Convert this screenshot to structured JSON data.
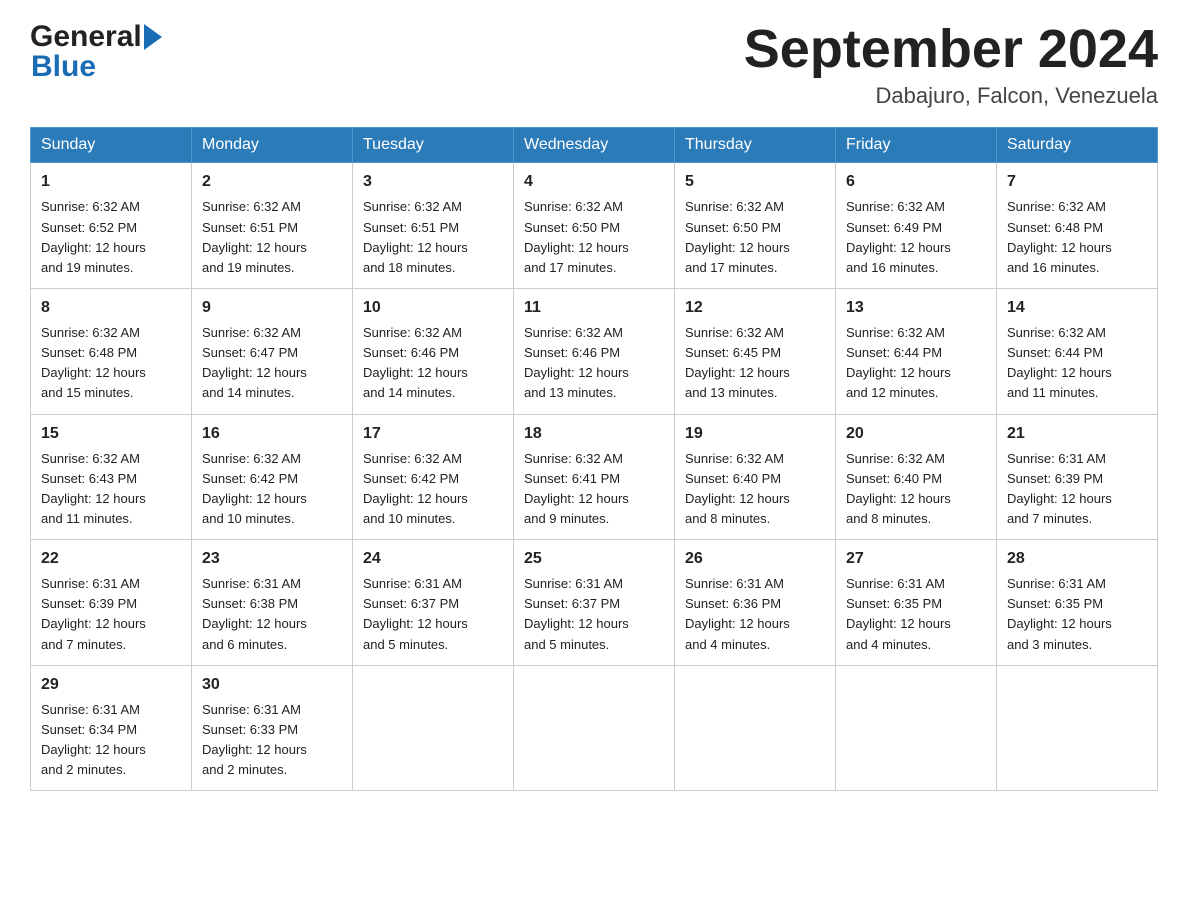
{
  "header": {
    "logo_general": "General",
    "logo_blue": "Blue",
    "month_title": "September 2024",
    "location": "Dabajuro, Falcon, Venezuela"
  },
  "days_of_week": [
    "Sunday",
    "Monday",
    "Tuesday",
    "Wednesday",
    "Thursday",
    "Friday",
    "Saturday"
  ],
  "weeks": [
    [
      {
        "day": "1",
        "sunrise": "6:32 AM",
        "sunset": "6:52 PM",
        "daylight": "12 hours and 19 minutes."
      },
      {
        "day": "2",
        "sunrise": "6:32 AM",
        "sunset": "6:51 PM",
        "daylight": "12 hours and 19 minutes."
      },
      {
        "day": "3",
        "sunrise": "6:32 AM",
        "sunset": "6:51 PM",
        "daylight": "12 hours and 18 minutes."
      },
      {
        "day": "4",
        "sunrise": "6:32 AM",
        "sunset": "6:50 PM",
        "daylight": "12 hours and 17 minutes."
      },
      {
        "day": "5",
        "sunrise": "6:32 AM",
        "sunset": "6:50 PM",
        "daylight": "12 hours and 17 minutes."
      },
      {
        "day": "6",
        "sunrise": "6:32 AM",
        "sunset": "6:49 PM",
        "daylight": "12 hours and 16 minutes."
      },
      {
        "day": "7",
        "sunrise": "6:32 AM",
        "sunset": "6:48 PM",
        "daylight": "12 hours and 16 minutes."
      }
    ],
    [
      {
        "day": "8",
        "sunrise": "6:32 AM",
        "sunset": "6:48 PM",
        "daylight": "12 hours and 15 minutes."
      },
      {
        "day": "9",
        "sunrise": "6:32 AM",
        "sunset": "6:47 PM",
        "daylight": "12 hours and 14 minutes."
      },
      {
        "day": "10",
        "sunrise": "6:32 AM",
        "sunset": "6:46 PM",
        "daylight": "12 hours and 14 minutes."
      },
      {
        "day": "11",
        "sunrise": "6:32 AM",
        "sunset": "6:46 PM",
        "daylight": "12 hours and 13 minutes."
      },
      {
        "day": "12",
        "sunrise": "6:32 AM",
        "sunset": "6:45 PM",
        "daylight": "12 hours and 13 minutes."
      },
      {
        "day": "13",
        "sunrise": "6:32 AM",
        "sunset": "6:44 PM",
        "daylight": "12 hours and 12 minutes."
      },
      {
        "day": "14",
        "sunrise": "6:32 AM",
        "sunset": "6:44 PM",
        "daylight": "12 hours and 11 minutes."
      }
    ],
    [
      {
        "day": "15",
        "sunrise": "6:32 AM",
        "sunset": "6:43 PM",
        "daylight": "12 hours and 11 minutes."
      },
      {
        "day": "16",
        "sunrise": "6:32 AM",
        "sunset": "6:42 PM",
        "daylight": "12 hours and 10 minutes."
      },
      {
        "day": "17",
        "sunrise": "6:32 AM",
        "sunset": "6:42 PM",
        "daylight": "12 hours and 10 minutes."
      },
      {
        "day": "18",
        "sunrise": "6:32 AM",
        "sunset": "6:41 PM",
        "daylight": "12 hours and 9 minutes."
      },
      {
        "day": "19",
        "sunrise": "6:32 AM",
        "sunset": "6:40 PM",
        "daylight": "12 hours and 8 minutes."
      },
      {
        "day": "20",
        "sunrise": "6:32 AM",
        "sunset": "6:40 PM",
        "daylight": "12 hours and 8 minutes."
      },
      {
        "day": "21",
        "sunrise": "6:31 AM",
        "sunset": "6:39 PM",
        "daylight": "12 hours and 7 minutes."
      }
    ],
    [
      {
        "day": "22",
        "sunrise": "6:31 AM",
        "sunset": "6:39 PM",
        "daylight": "12 hours and 7 minutes."
      },
      {
        "day": "23",
        "sunrise": "6:31 AM",
        "sunset": "6:38 PM",
        "daylight": "12 hours and 6 minutes."
      },
      {
        "day": "24",
        "sunrise": "6:31 AM",
        "sunset": "6:37 PM",
        "daylight": "12 hours and 5 minutes."
      },
      {
        "day": "25",
        "sunrise": "6:31 AM",
        "sunset": "6:37 PM",
        "daylight": "12 hours and 5 minutes."
      },
      {
        "day": "26",
        "sunrise": "6:31 AM",
        "sunset": "6:36 PM",
        "daylight": "12 hours and 4 minutes."
      },
      {
        "day": "27",
        "sunrise": "6:31 AM",
        "sunset": "6:35 PM",
        "daylight": "12 hours and 4 minutes."
      },
      {
        "day": "28",
        "sunrise": "6:31 AM",
        "sunset": "6:35 PM",
        "daylight": "12 hours and 3 minutes."
      }
    ],
    [
      {
        "day": "29",
        "sunrise": "6:31 AM",
        "sunset": "6:34 PM",
        "daylight": "12 hours and 2 minutes."
      },
      {
        "day": "30",
        "sunrise": "6:31 AM",
        "sunset": "6:33 PM",
        "daylight": "12 hours and 2 minutes."
      },
      null,
      null,
      null,
      null,
      null
    ]
  ],
  "labels": {
    "sunrise": "Sunrise:",
    "sunset": "Sunset:",
    "daylight": "Daylight:"
  }
}
